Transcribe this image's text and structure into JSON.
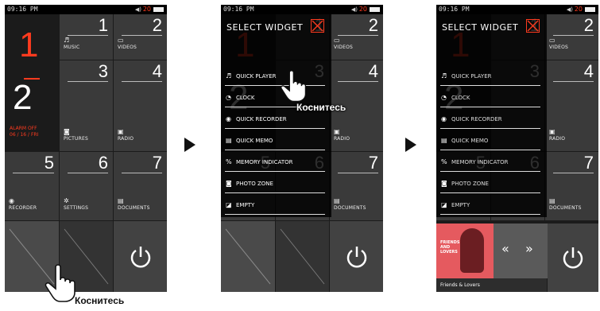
{
  "status": {
    "time": "09:16 PM",
    "volume_icon": "speaker-icon",
    "volume": "20"
  },
  "clock": {
    "hour": "1",
    "minute": "2",
    "alarm_line1": "ALARM OFF",
    "alarm_line2": "06 / 16 / FRI"
  },
  "tiles": [
    {
      "num": "1",
      "label": "MUSIC",
      "icon": "♬"
    },
    {
      "num": "2",
      "label": "VIDEOS",
      "icon": "▭"
    },
    {
      "num": "3",
      "label": "PICTURES",
      "icon": "◙"
    },
    {
      "num": "4",
      "label": "RADIO",
      "icon": "▣"
    },
    {
      "num": "5",
      "label": "RECORDER",
      "icon": "◉"
    },
    {
      "num": "6",
      "label": "SETTINGS",
      "icon": "✲"
    },
    {
      "num": "7",
      "label": "DOCUMENTS",
      "icon": "▤"
    }
  ],
  "widget_menu": {
    "title": "SELECT  WIDGET",
    "items": [
      {
        "icon": "♬",
        "label": "QUICK PLAYER"
      },
      {
        "icon": "◔",
        "label": "CLOCK"
      },
      {
        "icon": "◉",
        "label": "QUICK RECORDER"
      },
      {
        "icon": "▤",
        "label": "QUICK MEMO"
      },
      {
        "icon": "%",
        "label": "MEMORY INDICATOR"
      },
      {
        "icon": "◙",
        "label": "PHOTO ZONE"
      },
      {
        "icon": "◪",
        "label": "EMPTY"
      }
    ]
  },
  "player": {
    "album_text": "FRIENDS\nAND\nLOVERS",
    "prev": "«",
    "next": "»",
    "track": "Friends & Lovers"
  },
  "captions": {
    "touch": "Коснитесь"
  },
  "colors": {
    "accent": "#ff3b1f",
    "tile": "#3a3a3a",
    "background": "#1b1b1b"
  }
}
